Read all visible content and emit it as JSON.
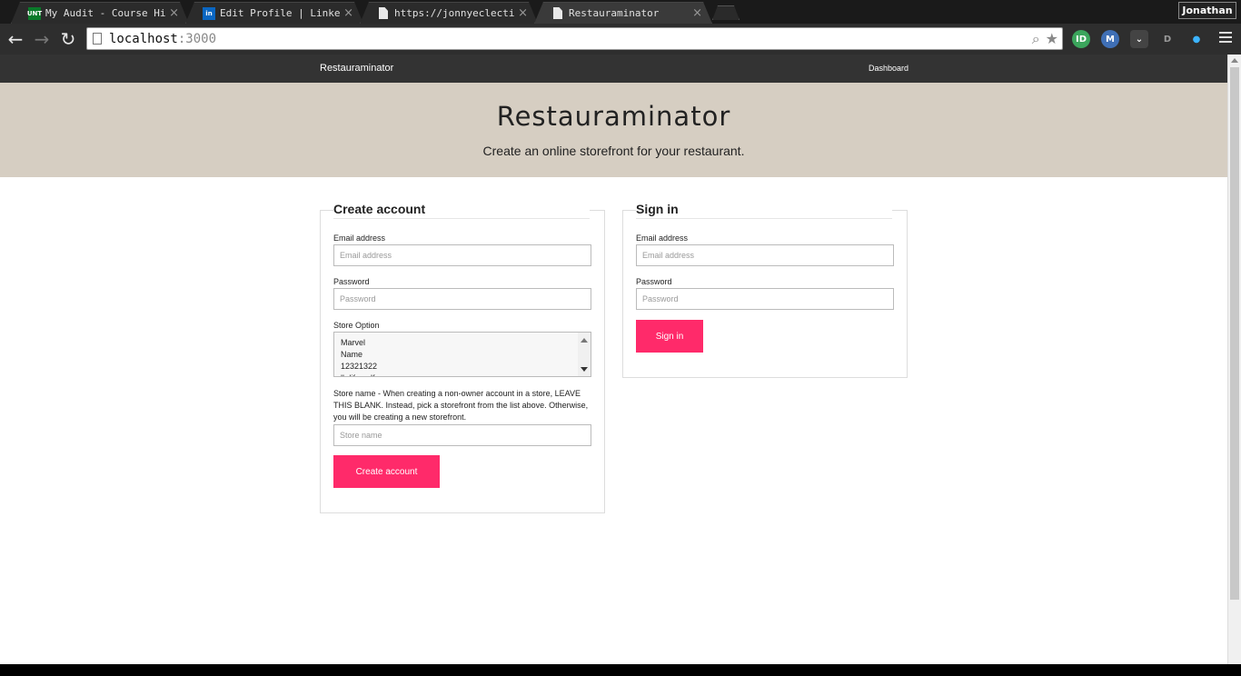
{
  "browser": {
    "tabs": [
      {
        "title": "My Audit - Course Histo",
        "favicon": "UNT"
      },
      {
        "title": "Edit Profile | LinkedIn",
        "favicon": "in"
      },
      {
        "title": "https://jonnyeclectic.g",
        "favicon": ""
      },
      {
        "title": "Restauraminator",
        "favicon": ""
      }
    ],
    "profile_name": "Jonathan",
    "url_host": "localhost",
    "url_port": ":3000",
    "extensions": [
      "ID",
      "M"
    ]
  },
  "sitenav": {
    "brand": "Restauraminator",
    "dashboard": "Dashboard"
  },
  "hero": {
    "title": "Restauraminator",
    "subtitle": "Create an online storefront for your restaurant."
  },
  "create_account": {
    "heading": "Create account",
    "email_label": "Email address",
    "email_placeholder": "Email address",
    "password_label": "Password",
    "password_placeholder": "Password",
    "store_option_label": "Store Option",
    "store_options": [
      "Marvel",
      "Name",
      "12321322",
      "lkdifsasdf"
    ],
    "store_name_help": "Store name - When creating a non-owner account in a store, LEAVE THIS BLANK. Instead, pick a storefront from the list above. Otherwise, you will be creating a new storefront.",
    "store_name_placeholder": "Store name",
    "submit_label": "Create account"
  },
  "sign_in": {
    "heading": "Sign in",
    "email_label": "Email address",
    "email_placeholder": "Email address",
    "password_label": "Password",
    "password_placeholder": "Password",
    "submit_label": "Sign in"
  },
  "colors": {
    "accent": "#ff2a6a",
    "hero_bg": "#d6cec2",
    "nav_bg": "#333333"
  }
}
